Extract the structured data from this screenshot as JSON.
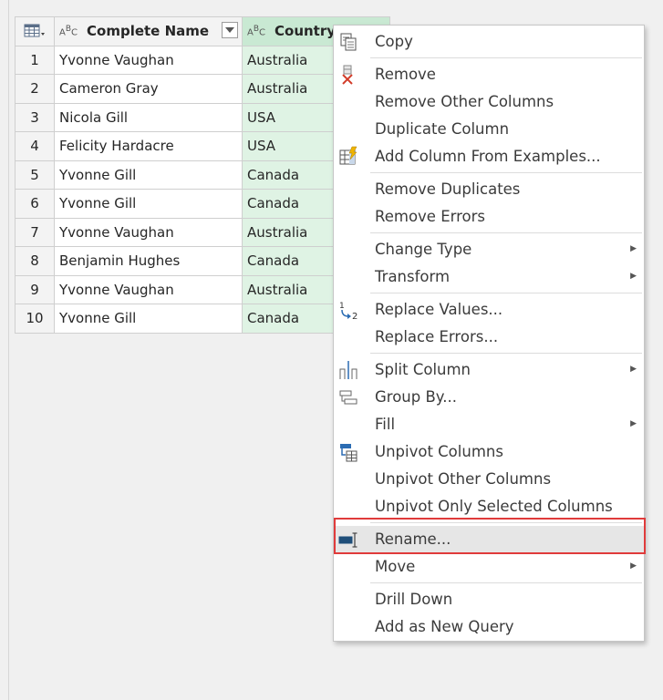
{
  "table": {
    "headers": {
      "name": "Complete Name",
      "country": "Country",
      "abc": "ABC"
    },
    "rows": [
      {
        "idx": "1",
        "name": "Yvonne Vaughan",
        "country": "Australia"
      },
      {
        "idx": "2",
        "name": "Cameron Gray",
        "country": "Australia"
      },
      {
        "idx": "3",
        "name": "Nicola Gill",
        "country": "USA"
      },
      {
        "idx": "4",
        "name": "Felicity Hardacre",
        "country": "USA"
      },
      {
        "idx": "5",
        "name": "Yvonne Gill",
        "country": "Canada"
      },
      {
        "idx": "6",
        "name": "Yvonne Gill",
        "country": "Canada"
      },
      {
        "idx": "7",
        "name": "Yvonne Vaughan",
        "country": "Australia"
      },
      {
        "idx": "8",
        "name": "Benjamin Hughes",
        "country": "Canada"
      },
      {
        "idx": "9",
        "name": "Yvonne Vaughan",
        "country": "Australia"
      },
      {
        "idx": "10",
        "name": "Yvonne Gill",
        "country": "Canada"
      }
    ]
  },
  "menu": {
    "items": [
      {
        "label": "Copy",
        "icon": "copy-icon"
      },
      {
        "label": "Remove",
        "icon": "remove-column-icon"
      },
      {
        "label": "Remove Other Columns"
      },
      {
        "label": "Duplicate Column"
      },
      {
        "label": "Add Column From Examples...",
        "icon": "add-from-examples-icon"
      },
      {
        "label": "Remove Duplicates"
      },
      {
        "label": "Remove Errors"
      },
      {
        "label": "Change Type",
        "submenu": true
      },
      {
        "label": "Transform",
        "submenu": true
      },
      {
        "label": "Replace Values...",
        "icon": "replace-values-icon"
      },
      {
        "label": "Replace Errors..."
      },
      {
        "label": "Split Column",
        "icon": "split-column-icon",
        "submenu": true
      },
      {
        "label": "Group By...",
        "icon": "group-by-icon"
      },
      {
        "label": "Fill",
        "submenu": true
      },
      {
        "label": "Unpivot Columns",
        "icon": "unpivot-icon"
      },
      {
        "label": "Unpivot Other Columns"
      },
      {
        "label": "Unpivot Only Selected Columns"
      },
      {
        "label": "Rename...",
        "icon": "rename-icon",
        "highlighted": true
      },
      {
        "label": "Move",
        "submenu": true
      },
      {
        "label": "Drill Down"
      },
      {
        "label": "Add as New Query"
      }
    ]
  },
  "colors": {
    "selected_column": "#dff3e4",
    "selected_header": "#c9e9d3",
    "highlight_border": "#e03b3b",
    "highlight_fill": "#e6e6e6"
  }
}
